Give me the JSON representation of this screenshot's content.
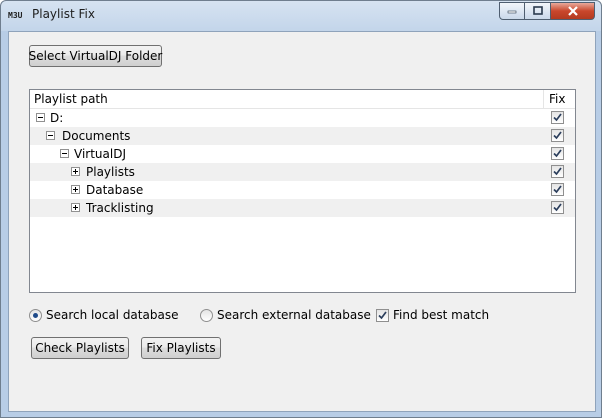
{
  "window": {
    "app_icon_text": "M3U",
    "title": "Playlist Fix"
  },
  "toolbar": {
    "select_folder_label": "Select VirtualDJ Folder"
  },
  "tree": {
    "columns": {
      "path": "Playlist path",
      "fix": "Fix"
    },
    "items": [
      {
        "label": "D:",
        "expanded": true,
        "checked": true
      },
      {
        "label": "Documents",
        "expanded": true,
        "checked": true
      },
      {
        "label": "VirtualDJ",
        "expanded": true,
        "checked": true
      },
      {
        "label": "Playlists",
        "expanded": false,
        "checked": true
      },
      {
        "label": "Database",
        "expanded": false,
        "checked": true
      },
      {
        "label": "Tracklisting",
        "expanded": false,
        "checked": true
      }
    ]
  },
  "options": {
    "local_label": "Search local database",
    "local_selected": true,
    "external_label": "Search external database",
    "external_selected": false,
    "best_match_label": "Find best match",
    "best_match_checked": true
  },
  "actions": {
    "check_label": "Check Playlists",
    "fix_label": "Fix Playlists"
  }
}
